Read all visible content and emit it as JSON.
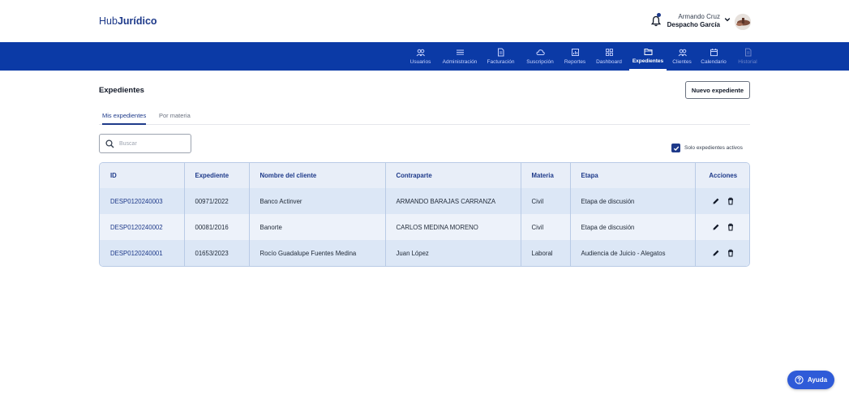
{
  "brand": {
    "prefix": "Hub",
    "name": "Jurídico"
  },
  "user": {
    "name": "Armando Cruz",
    "organization": "Despacho García"
  },
  "nav": {
    "items": [
      {
        "label": "Usuarios",
        "icon": "users-icon",
        "state": "normal"
      },
      {
        "label": "Administración",
        "icon": "menu-lines-icon",
        "state": "normal"
      },
      {
        "label": "Facturación",
        "icon": "document-icon",
        "state": "normal"
      },
      {
        "label": "Suscripción",
        "icon": "cloud-icon",
        "state": "normal"
      },
      {
        "label": "Reportes",
        "icon": "report-icon",
        "state": "normal"
      },
      {
        "label": "Dashboard",
        "icon": "grid-icon",
        "state": "normal"
      },
      {
        "label": "Expedientes",
        "icon": "folder-icon",
        "state": "active"
      },
      {
        "label": "Clientes",
        "icon": "users-icon",
        "state": "normal"
      },
      {
        "label": "Calendario",
        "icon": "calendar-icon",
        "state": "normal"
      },
      {
        "label": "Historial",
        "icon": "document-icon",
        "state": "disabled"
      }
    ]
  },
  "page": {
    "title": "Expedientes",
    "new_button": "Nuevo expediente",
    "tabs": [
      {
        "label": "Mis expedientes",
        "active": true
      },
      {
        "label": "Por materia",
        "active": false
      }
    ],
    "search": {
      "placeholder": "Buscar",
      "value": ""
    },
    "filter": {
      "label": "Solo expedientes activos",
      "checked": true
    }
  },
  "table": {
    "headers": [
      "ID",
      "Expediente",
      "Nombre del cliente",
      "Contraparte",
      "Materia",
      "Etapa",
      "Acciones"
    ],
    "rows": [
      [
        "DESP0120240003",
        "00971/2022",
        "Banco Actinver",
        "ARMANDO BARAJAS CARRANZA",
        "Civil",
        "Etapa de discusión"
      ],
      [
        "DESP0120240002",
        "00081/2016",
        "Banorte",
        "CARLOS MEDINA MORENO",
        "Civil",
        "Etapa de discusión"
      ],
      [
        "DESP0120240001",
        "01653/2023",
        "Rocío Guadalupe Fuentes Medina",
        "Juan López",
        "Laboral",
        "Audiencia de Juicio - Alegatos"
      ]
    ]
  },
  "help": {
    "label": "Ayuda"
  },
  "colors": {
    "primary": "#0b3aa6",
    "accent": "#1e3a8a",
    "row_dark": "#dce7f6",
    "row_light": "#edf2fa",
    "help": "#2f5bd8"
  }
}
